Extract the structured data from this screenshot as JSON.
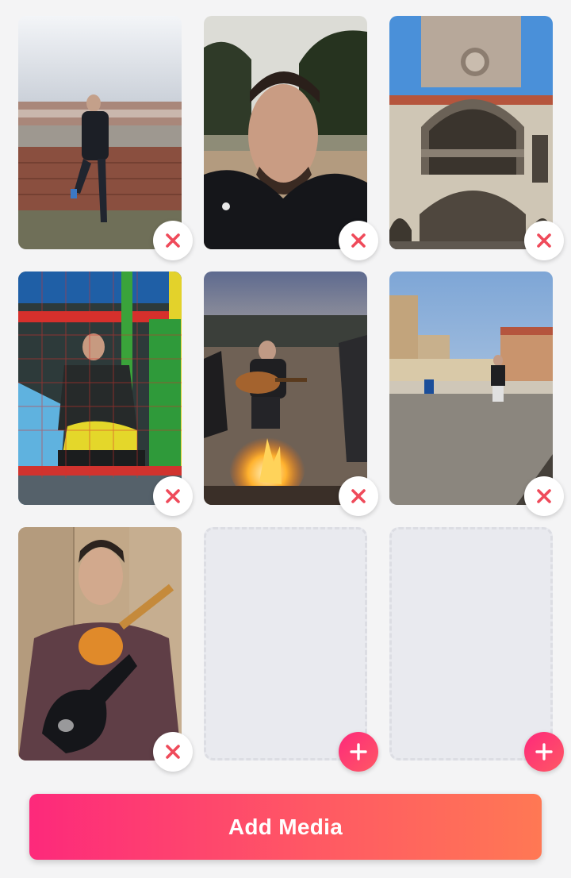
{
  "colors": {
    "background": "#f4f4f5",
    "accent_start": "#fd297b",
    "accent_end": "#ff7854",
    "remove_icon": "#ef4a5a",
    "empty_slot": "#e9eaef"
  },
  "media_grid": {
    "slots": [
      {
        "state": "photo",
        "image_icon": "photo-man-on-city-wall",
        "action_icon": "close-icon"
      },
      {
        "state": "photo",
        "image_icon": "photo-selfie-man-outdoors",
        "action_icon": "close-icon"
      },
      {
        "state": "photo",
        "image_icon": "photo-stone-building-arches",
        "action_icon": "close-icon"
      },
      {
        "state": "photo",
        "image_icon": "photo-man-in-playground-net",
        "action_icon": "close-icon"
      },
      {
        "state": "photo",
        "image_icon": "photo-campfire-guitar-night",
        "action_icon": "close-icon"
      },
      {
        "state": "photo",
        "image_icon": "photo-man-in-plaza",
        "action_icon": "close-icon"
      },
      {
        "state": "photo",
        "image_icon": "photo-man-with-guitar",
        "action_icon": "close-icon"
      },
      {
        "state": "empty",
        "action_icon": "plus-icon"
      },
      {
        "state": "empty",
        "action_icon": "plus-icon"
      }
    ]
  },
  "add_media_button": {
    "label": "Add Media"
  }
}
